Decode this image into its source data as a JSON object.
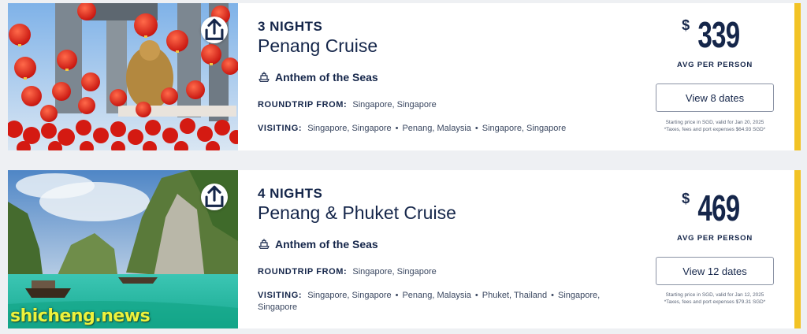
{
  "cruises": [
    {
      "nights": "3 NIGHTS",
      "title": "Penang Cruise",
      "ship": "Anthem of the Seas",
      "roundtrip_label": "ROUNDTRIP FROM:",
      "roundtrip": "Singapore, Singapore",
      "visiting_label": "VISITING:",
      "visiting": [
        "Singapore, Singapore",
        "Penang, Malaysia",
        "Singapore, Singapore"
      ],
      "currency": "$",
      "price": "339",
      "price_label": "AVG PER PERSON",
      "button": "View 8 dates",
      "note1": "Starting price in SGD, valid for Jan 20, 2025",
      "note2": "*Taxes, fees and port expenses $64.93 SGD*"
    },
    {
      "nights": "4 NIGHTS",
      "title": "Penang & Phuket Cruise",
      "ship": "Anthem of the Seas",
      "roundtrip_label": "ROUNDTRIP FROM:",
      "roundtrip": "Singapore, Singapore",
      "visiting_label": "VISITING:",
      "visiting": [
        "Singapore, Singapore",
        "Penang, Malaysia",
        "Phuket, Thailand",
        "Singapore,",
        "Singapore"
      ],
      "currency": "$",
      "price": "469",
      "price_label": "AVG PER PERSON",
      "button": "View 12 dates",
      "note1": "Starting price in SGD, valid for Jan 12, 2025",
      "note2": "*Taxes, fees and port expenses $79.31 SGD*"
    }
  ],
  "icons": {
    "share": "share-icon",
    "ship": "ship-icon"
  },
  "colors": {
    "accent": "#f2c325",
    "navy": "#15264a"
  },
  "watermark": "shicheng.news"
}
